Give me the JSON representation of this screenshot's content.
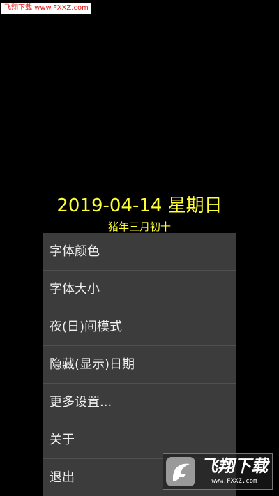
{
  "watermark": {
    "top_text": "飞翔下载 www.FXXZ.com",
    "logo_text": "飞翔下载",
    "logo_url": "www.FXXZ.com",
    "color": "#e02020"
  },
  "clock": {
    "date": "2019-04-14 星期日",
    "lunar": "猪年三月初十",
    "color": "#ffff33"
  },
  "menu": {
    "items": [
      {
        "label": "字体颜色"
      },
      {
        "label": "字体大小"
      },
      {
        "label": "夜(日)间模式"
      },
      {
        "label": "隐藏(显示)日期"
      },
      {
        "label": "更多设置..."
      },
      {
        "label": "关于"
      },
      {
        "label": "退出"
      }
    ],
    "background": "#3c3c3c"
  }
}
